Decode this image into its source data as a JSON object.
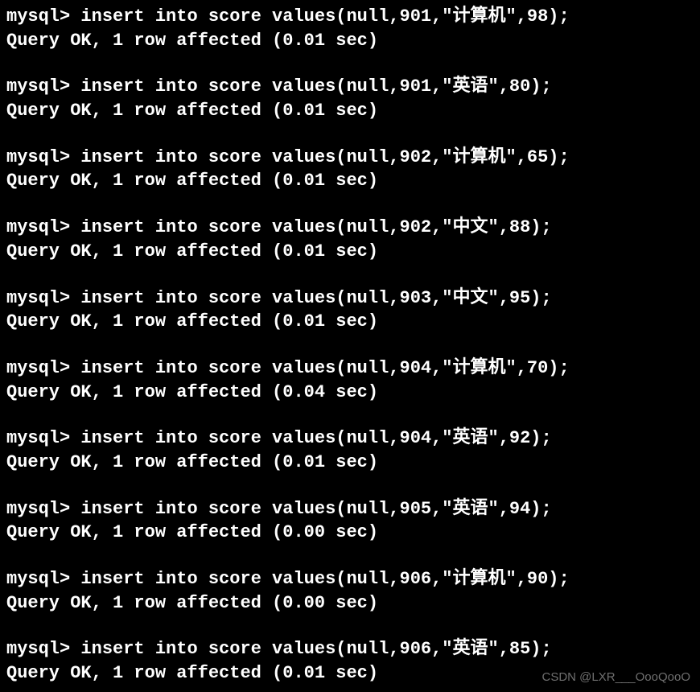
{
  "prompt": "mysql> ",
  "result_prefix": "Query OK, 1 row affected (",
  "result_suffix": " sec)",
  "entries": [
    {
      "command": "insert into score values(null,901,\"计算机\",98);",
      "time": "0.01"
    },
    {
      "command": "insert into score values(null,901,\"英语\",80);",
      "time": "0.01"
    },
    {
      "command": "insert into score values(null,902,\"计算机\",65);",
      "time": "0.01"
    },
    {
      "command": "insert into score values(null,902,\"中文\",88);",
      "time": "0.01"
    },
    {
      "command": "insert into score values(null,903,\"中文\",95);",
      "time": "0.01"
    },
    {
      "command": "insert into score values(null,904,\"计算机\",70);",
      "time": "0.04"
    },
    {
      "command": "insert into score values(null,904,\"英语\",92);",
      "time": "0.01"
    },
    {
      "command": "insert into score values(null,905,\"英语\",94);",
      "time": "0.00"
    },
    {
      "command": "insert into score values(null,906,\"计算机\",90);",
      "time": "0.00"
    },
    {
      "command": "insert into score values(null,906,\"英语\",85);",
      "time": "0.01"
    }
  ],
  "watermark": "CSDN @LXR___OooQooO"
}
